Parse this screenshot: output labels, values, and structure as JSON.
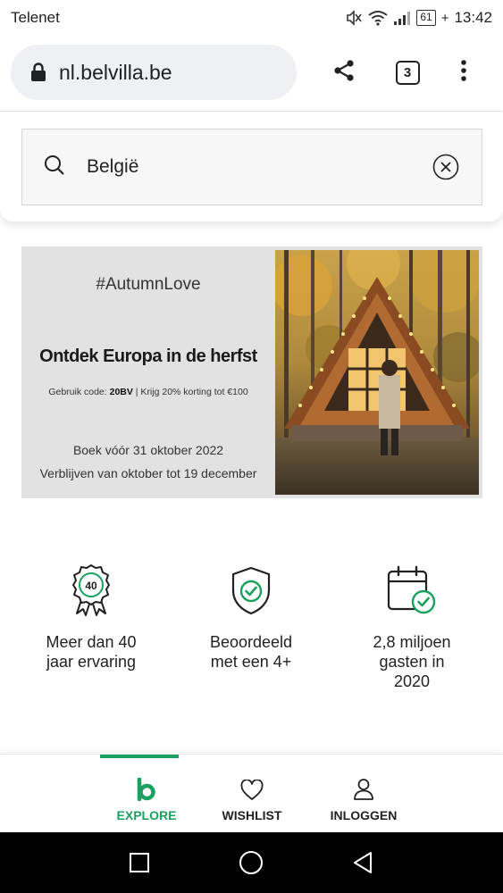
{
  "status_bar": {
    "carrier": "Telenet",
    "battery": "61",
    "time": "13:42"
  },
  "browser": {
    "url": "nl.belvilla.be",
    "tab_count": "3"
  },
  "search": {
    "value": "België"
  },
  "banner": {
    "hashtag": "#AutumnLove",
    "headline": "Ontdek Europa in de herfst",
    "code_prefix": "Gebruik code: ",
    "code": "20BV",
    "code_suffix": " | Krijg 20% korting tot €100",
    "book_by": "Boek vóór 31 oktober 2022",
    "stay_period": "Verblijven van oktober tot 19 december"
  },
  "features": [
    {
      "icon": "award-ribbon-icon",
      "badge": "40",
      "label": "Meer dan 40 jaar ervaring"
    },
    {
      "icon": "shield-check-icon",
      "label": "Beoordeeld met een 4+"
    },
    {
      "icon": "calendar-check-icon",
      "label": "2,8 miljoen gasten in 2020"
    }
  ],
  "bottom_nav": {
    "items": [
      {
        "label": "EXPLORE",
        "icon": "belvilla-logo-icon",
        "active": true
      },
      {
        "label": "WISHLIST",
        "icon": "heart-icon",
        "active": false
      },
      {
        "label": "INLOGGEN",
        "icon": "user-icon",
        "active": false
      }
    ]
  },
  "colors": {
    "accent": "#1aa15f",
    "banner_bg": "#e2e2e2",
    "url_pill_bg": "#eef0f3"
  }
}
